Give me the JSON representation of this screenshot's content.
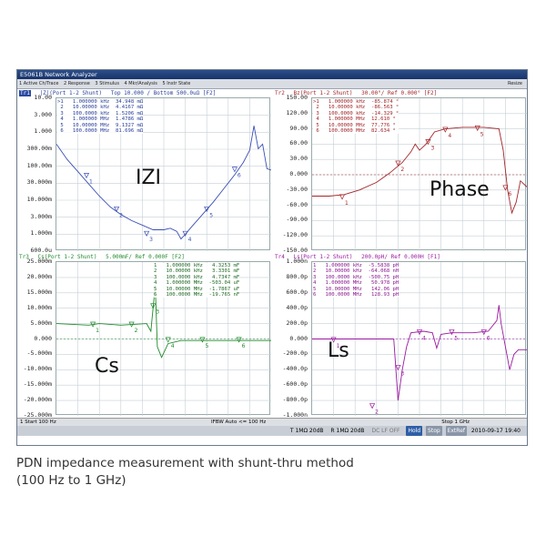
{
  "window": {
    "title": "E5061B Network Analyzer",
    "menu": [
      "1 Active Ch/Trace",
      "2 Response",
      "3 Stimulus",
      "4 Mkr/Analysis",
      "5 Instr State"
    ],
    "menu_right": "Resize"
  },
  "panels": {
    "z": {
      "trace": "Tr1",
      "header": "|Z|(Port 1-2 Shunt)",
      "scale": "Top 10.000 / Bottom 500.0uΩ [F2]",
      "color": "#3a4fb5",
      "yticks": [
        "10.00",
        "3.000",
        "1.000",
        "300.00m",
        "100.00m",
        "30.000m",
        "10.000m",
        "3.000m",
        "1.000m",
        "600.0u"
      ],
      "markers": [
        ">1   1.000000 kHz  34.948 mΩ",
        " 2   10.00000 kHz  4.4167 mΩ",
        " 3   100.0000 kHz  1.5206 mΩ",
        " 4   1.000000 MHz  1.4786 mΩ",
        " 5   10.00000 MHz  9.1327 mΩ",
        " 6   100.0000 MHz  81.696 mΩ"
      ],
      "label": "IZI"
    },
    "phase": {
      "trace": "Tr2",
      "header": "Bz(Port 1-2 Shunt)",
      "scale": "30.00°/ Ref 0.000° [F2]",
      "color": "#a3262a",
      "yticks": [
        "150.00",
        "120.00",
        "90.00",
        "60.00",
        "30.00",
        "0.000",
        "-30.00",
        "-60.00",
        "-90.00",
        "-120.00",
        "-150.00"
      ],
      "markers": [
        ">1   1.000000 kHz  -85.874 °",
        " 2   10.00000 kHz  -86.563 °",
        " 3   100.0000 kHz  -14.329 °",
        " 4   1.000000 MHz  12.610 °",
        " 5   10.00000 MHz  77.776 °",
        " 6   100.0000 MHz  82.634 °"
      ],
      "label": "Phase"
    },
    "cs": {
      "trace": "Tr3",
      "header": "Cs(Port 1-2 Shunt)",
      "scale": "5.000mF/ Ref 0.000F [F2]",
      "color": "#1f8a2a",
      "yticks": [
        "25.000m",
        "20.000m",
        "15.000m",
        "10.000m",
        "5.000m",
        "0.000",
        "-5.000m",
        "-10.000m",
        "-15.000m",
        "-20.000m",
        "-25.000m"
      ],
      "markers": [
        "1   1.000000 kHz   4.3253 mF",
        "2   10.00000 kHz   3.3301 mF",
        "3   100.0000 kHz   4.7347 mF",
        "4   1.000000 MHz  -503.04 uF",
        "5   10.00000 MHz  -1.7867 uF",
        "6   100.0000 MHz  -19.765 nF"
      ],
      "label": "Cs"
    },
    "ls": {
      "trace": "Tr4",
      "header": "Ls(Port 1-2 Shunt)",
      "scale": "200.0pH/ Ref 0.000H [F1]",
      "color": "#9a1aa0",
      "yticks": [
        "1.000n",
        "800.0p",
        "600.0p",
        "400.0p",
        "200.0p",
        "0.000",
        "-200.0p",
        "-400.0p",
        "-600.0p",
        "-800.0p",
        "-1.000n"
      ],
      "markers": [
        "1   1.000000 kHz  -5.5838 pH",
        "2   10.00000 kHz  -64.068 nH",
        "3   100.0000 kHz  -500.75 pH",
        "4   1.000000 MHz   50.978 pH",
        "5   10.00000 MHz   142.06 pH",
        "6   100.0000 MHz   128.93 pH"
      ],
      "label": "Ls"
    }
  },
  "status": {
    "start": "1  Start 100 Hz",
    "ifbw": "IFBW Auto <= 100 Hz",
    "stop": "Stop 1 GHz",
    "row2": [
      "T 1MΩ 20dB",
      "R 1MΩ 20dB",
      "DC LF OFF"
    ],
    "badges": [
      "Hold",
      "Stop",
      "ExtRef"
    ],
    "datetime": "2010-09-17 19:40"
  },
  "caption": {
    "line1": "PDN impedance measurement with shunt-thru method",
    "line2": "(100 Hz to 1 GHz)"
  }
}
